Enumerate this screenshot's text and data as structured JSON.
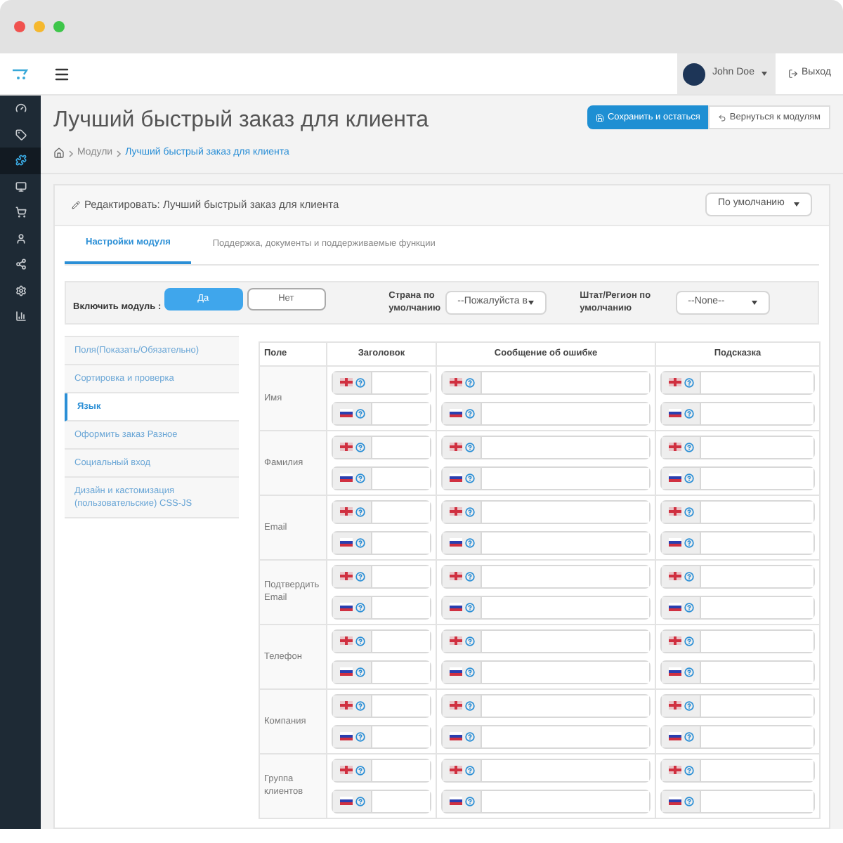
{
  "header": {
    "user": "John Doe",
    "logout": "Выход"
  },
  "sidebar": {
    "items": [
      {
        "selected": false
      },
      {
        "selected": false
      },
      {
        "selected": true
      },
      {
        "selected": false
      },
      {
        "selected": false
      },
      {
        "selected": false
      },
      {
        "selected": false
      },
      {
        "selected": false
      },
      {
        "selected": false
      }
    ]
  },
  "page": {
    "title": "Лучший быстрый заказ для клиента",
    "breadcrumbs": [
      "Модули",
      "Лучший быстрый заказ для клиента"
    ],
    "save_button": "Сохранить и остаться",
    "back_button": "Вернуться к модулям"
  },
  "panel": {
    "heading": "Редактировать: Лучший быстрый заказ для клиента",
    "store_select": "По умолчанию"
  },
  "tabs": [
    {
      "label": "Настройки модуля",
      "selected": true
    },
    {
      "label": "Поддержка, документы и поддерживаемые функции",
      "selected": false
    }
  ],
  "settings": {
    "enable_label": "Включить модуль :",
    "options": [
      {
        "label": "Да",
        "selected": true
      },
      {
        "label": "Нет",
        "selected": false
      }
    ],
    "country_label": "Страна по умолчанию",
    "country_value": "--Пожалуйста в",
    "region_label": "Штат/Регион по умолчанию",
    "region_value": "--None--"
  },
  "sections": [
    {
      "label": "Поля(Показать/Обязательно)",
      "selected": false
    },
    {
      "label": "Сортировка и проверка",
      "selected": false
    },
    {
      "label": "Язык",
      "selected": true
    },
    {
      "label": "Оформить заказ Разное",
      "selected": false
    },
    {
      "label": "Социальный вход",
      "selected": false
    },
    {
      "label": "Дизайн и кастомизация (пользовательские) CSS-JS",
      "selected": false
    }
  ],
  "table": {
    "columns": [
      "Поле",
      "Заголовок",
      "Сообщение об ошибке",
      "Подсказка"
    ],
    "rows": [
      {
        "label": "Имя"
      },
      {
        "label": "Фамилия"
      },
      {
        "label": "Email"
      },
      {
        "label": "Подтвердить Email"
      },
      {
        "label": "Телефон"
      },
      {
        "label": "Компания"
      },
      {
        "label": "Группа клиентов"
      }
    ]
  }
}
